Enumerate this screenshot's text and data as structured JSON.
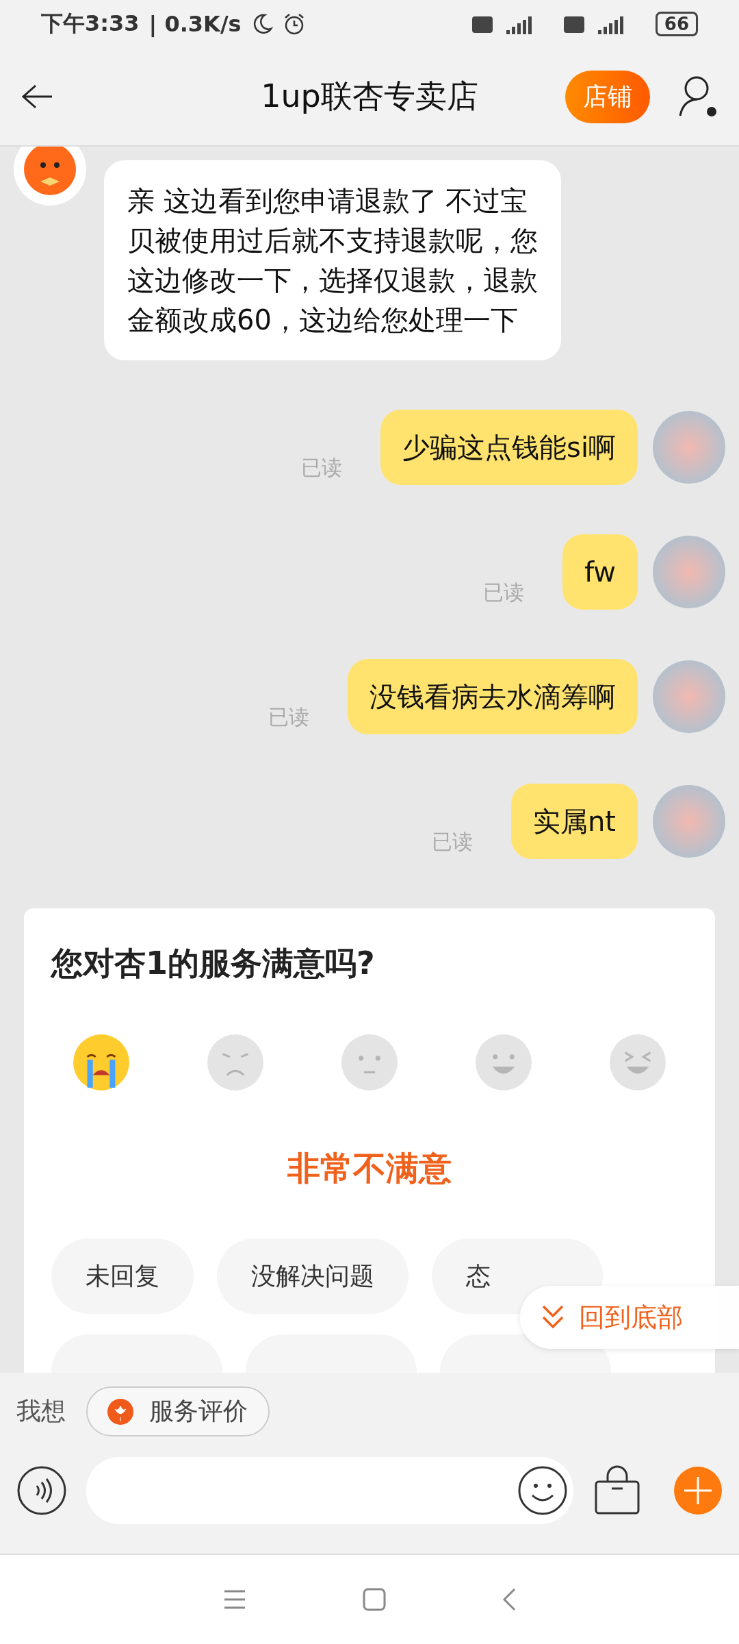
{
  "status_bar": {
    "time": "下午3:33",
    "speed": "| 0.3K/s",
    "battery": "66"
  },
  "header": {
    "title": "1up联杏专卖店",
    "shop_button": "店铺"
  },
  "messages": [
    {
      "kind": "left",
      "text": "亲 这边看到您申请退款了  不过宝贝被使用过后就不支持退款呢，您这边修改一下，选择仅退款，退款金额改成60，这边给您处理一下"
    },
    {
      "kind": "right",
      "text": "少骗这点钱能si啊",
      "read": "已读"
    },
    {
      "kind": "right",
      "text": "fw",
      "read": "已读"
    },
    {
      "kind": "right",
      "text": "没钱看病去水滴筹啊",
      "read": "已读"
    },
    {
      "kind": "right",
      "text": "实属nt",
      "read": "已读"
    }
  ],
  "survey": {
    "title": "您对杏1的服务满意吗?",
    "result": "非常不满意",
    "ratings": [
      {
        "kind": "crying",
        "selected": true
      },
      {
        "kind": "frown",
        "selected": false
      },
      {
        "kind": "neutral",
        "selected": false
      },
      {
        "kind": "smile",
        "selected": false
      },
      {
        "kind": "laugh",
        "selected": false
      }
    ],
    "tags": [
      "未回复",
      "没解决问题",
      "态"
    ]
  },
  "scroll_bottom_button": "回到底部",
  "quick_bar": {
    "label": "我想",
    "chip": "服务评价"
  }
}
